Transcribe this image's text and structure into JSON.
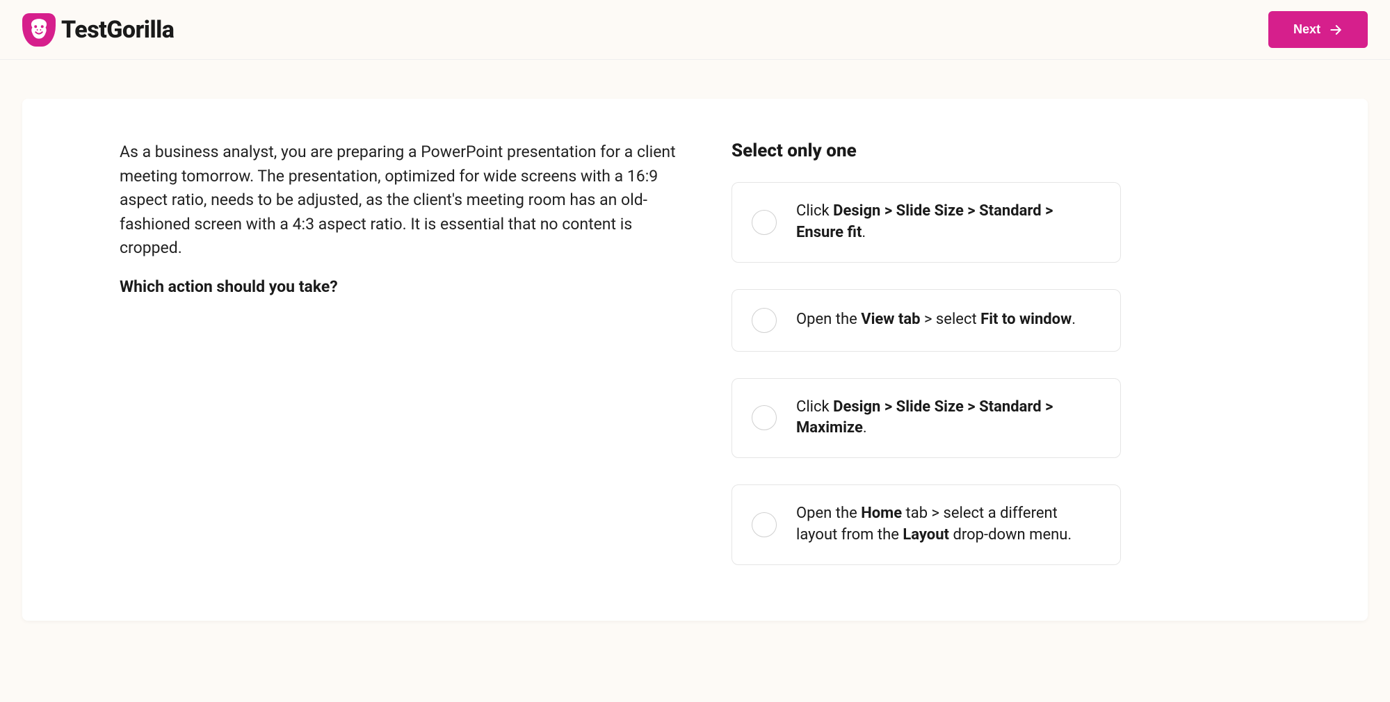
{
  "header": {
    "brand": "TestGorilla",
    "next_label": "Next"
  },
  "question": {
    "body": "As a business analyst, you are preparing a PowerPoint presentation for a client meeting tomorrow. The presentation, optimized for wide screens with a 16:9 aspect ratio, needs to be adjusted, as the client's meeting room has an old-fashioned screen with a 4:3 aspect ratio. It is essential that no content is cropped.",
    "prompt": "Which action should you take?"
  },
  "answers": {
    "heading": "Select only one",
    "options": [
      {
        "segments": [
          {
            "t": "Click ",
            "b": false
          },
          {
            "t": "Design > Slide Size > Standard > Ensure fit",
            "b": true
          },
          {
            "t": ".",
            "b": false
          }
        ]
      },
      {
        "segments": [
          {
            "t": "Open the ",
            "b": false
          },
          {
            "t": "View tab",
            "b": true
          },
          {
            "t": " > select ",
            "b": false
          },
          {
            "t": "Fit to window",
            "b": true
          },
          {
            "t": ".",
            "b": false
          }
        ]
      },
      {
        "segments": [
          {
            "t": "Click ",
            "b": false
          },
          {
            "t": "Design > Slide Size > Standard > Maximize",
            "b": true
          },
          {
            "t": ".",
            "b": false
          }
        ]
      },
      {
        "segments": [
          {
            "t": "Open the ",
            "b": false
          },
          {
            "t": "Home",
            "b": true
          },
          {
            "t": " tab > select a different layout from the ",
            "b": false
          },
          {
            "t": "Layout",
            "b": true
          },
          {
            "t": " drop-down menu.",
            "b": false
          }
        ]
      }
    ]
  }
}
